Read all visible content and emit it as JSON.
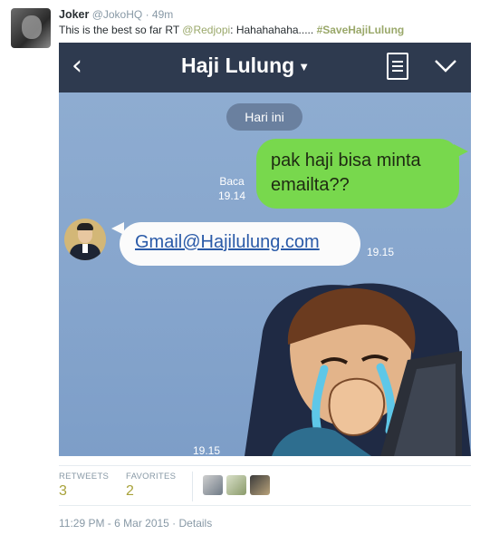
{
  "tweet": {
    "display_name": "Joker",
    "handle": "@JokoHQ",
    "time_ago": "49m",
    "text_prefix": "This is the best so far RT ",
    "mention": "@Redjopi",
    "text_middle": ": Hahahahaha..... ",
    "hashtag": "#SaveHajiLulung"
  },
  "chat": {
    "back_glyph": "‹",
    "title": "Haji Lulung",
    "title_caret": "▼",
    "date_label": "Hari ini",
    "sent_message_line1": "pak haji bisa minta",
    "sent_message_line2": "emailta??",
    "read_label": "Baca",
    "read_time": "19.14",
    "reply_link": "Gmail@Hajilulung.com",
    "reply_time": "19.15",
    "sticker_time": "19.15",
    "icons": [
      "back-arrow-icon",
      "caret-down-icon",
      "notes-icon",
      "chevron-down-icon"
    ]
  },
  "stats": {
    "retweets_label": "RETWEETS",
    "retweets_count": "3",
    "favorites_label": "FAVORITES",
    "favorites_count": "2"
  },
  "footer": {
    "time": "11:29 PM - 6 Mar 2015",
    "separator": " · ",
    "details": "Details"
  },
  "colors": {
    "chat_bar": "#2e3a4f",
    "sent_bubble": "#78d84d",
    "chat_background": "#87a6cd",
    "link": "#2a5aa8",
    "hashtag": "#9aa86a",
    "stat_number": "#a8a23a"
  }
}
